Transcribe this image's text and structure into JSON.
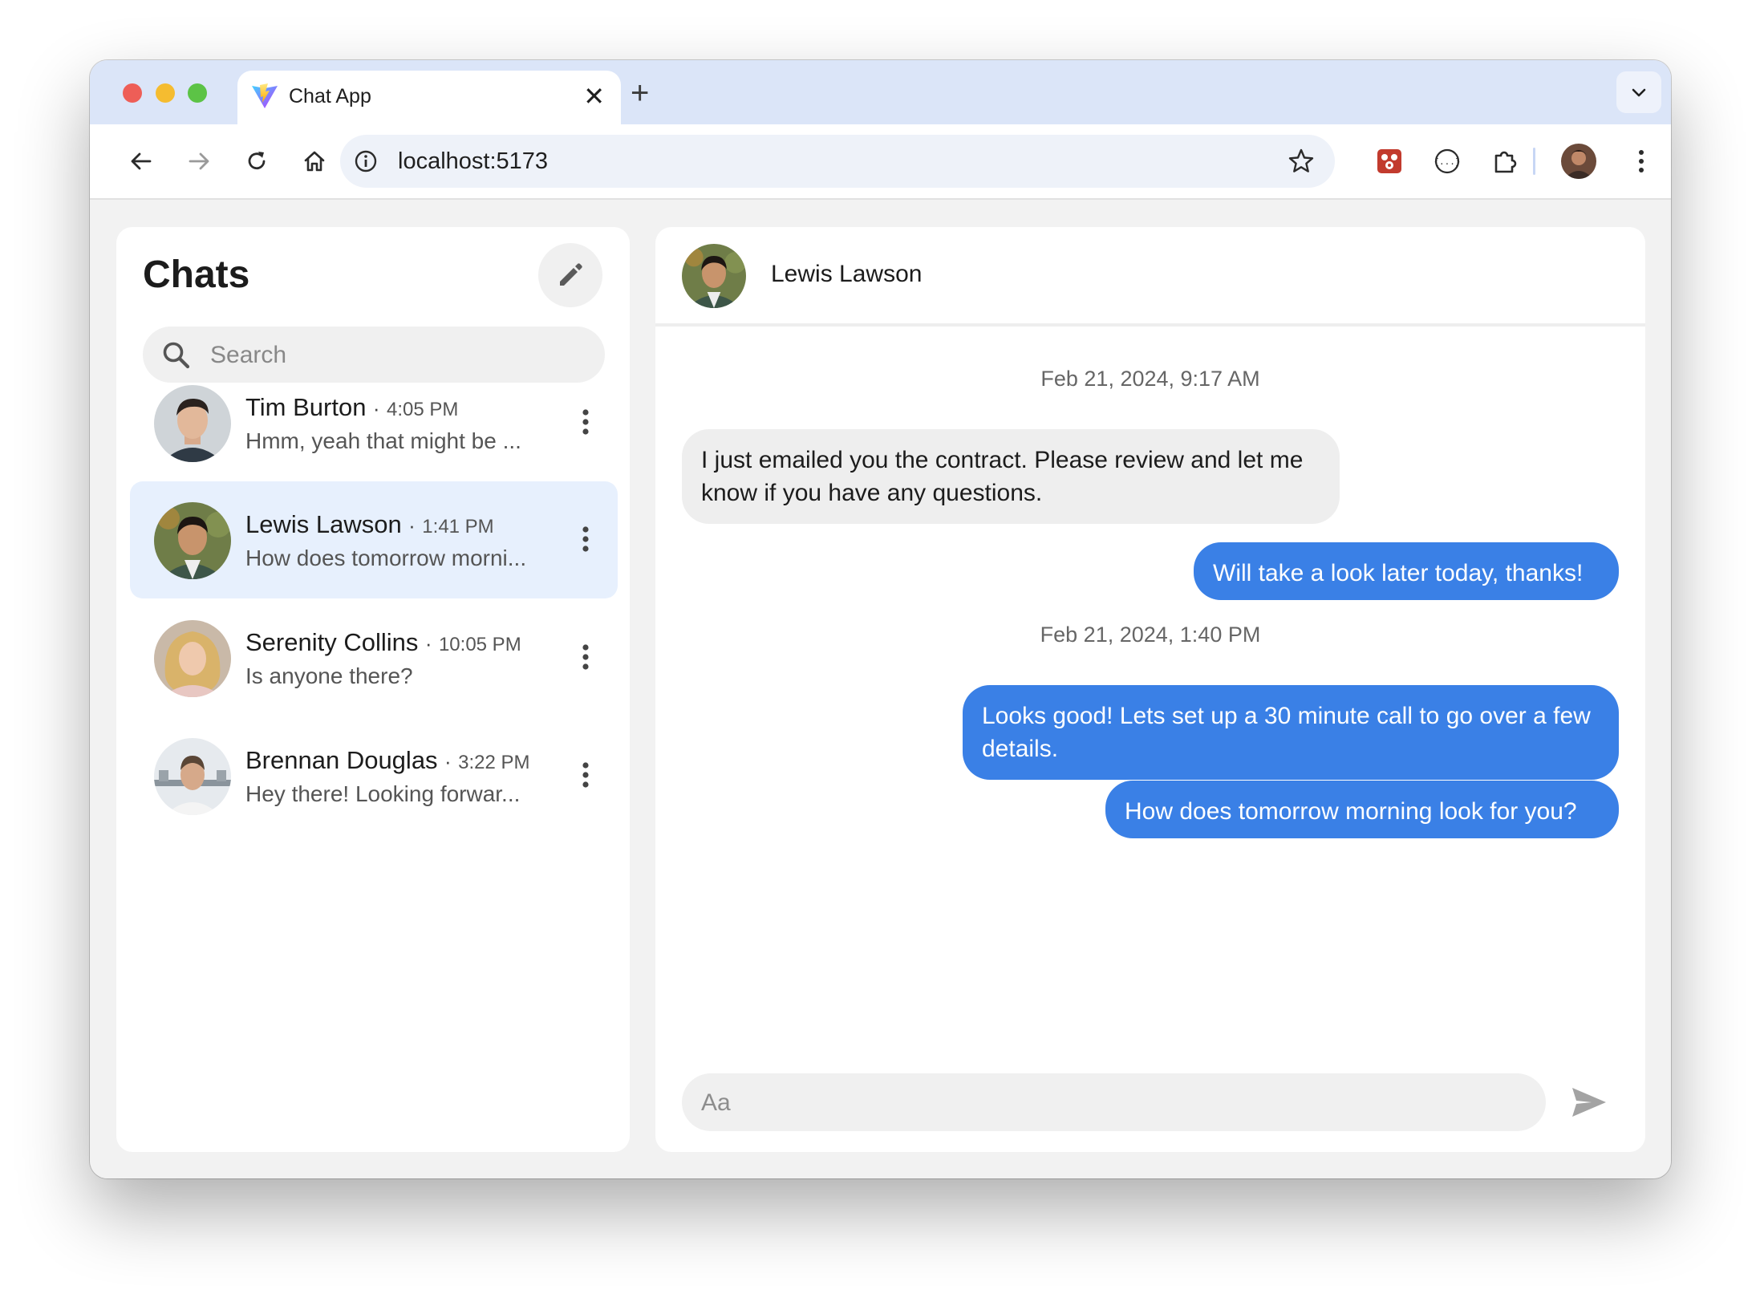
{
  "browser": {
    "tab_title": "Chat App",
    "tab_close": "✕",
    "new_tab": "+",
    "url": "localhost:5173"
  },
  "sidebar": {
    "title": "Chats",
    "search_placeholder": "Search",
    "chats": [
      {
        "name": "Tim Burton",
        "separator": "·",
        "time": "4:05 PM",
        "preview": "Hmm, yeah that might be ...",
        "active": false
      },
      {
        "name": "Lewis Lawson",
        "separator": "·",
        "time": "1:41 PM",
        "preview": "How does tomorrow morni...",
        "active": true
      },
      {
        "name": "Serenity Collins",
        "separator": "·",
        "time": "10:05 PM",
        "preview": "Is anyone there?",
        "active": false
      },
      {
        "name": "Brennan Douglas",
        "separator": "·",
        "time": "3:22 PM",
        "preview": "Hey there! Looking forwar...",
        "active": false
      }
    ]
  },
  "conversation": {
    "contact_name": "Lewis Lawson",
    "timestamps": [
      "Feb 21, 2024, 9:17 AM",
      "Feb 21, 2024, 1:40 PM"
    ],
    "messages": [
      {
        "direction": "incoming",
        "text": "I just emailed you the contract. Please review and let me know if you have any questions."
      },
      {
        "direction": "outgoing",
        "text": "Will take a look later today, thanks!"
      },
      {
        "direction": "outgoing",
        "text": "Looks good! Lets set up a 30 minute call to go over a few details."
      },
      {
        "direction": "outgoing",
        "text": "How does tomorrow morning look for you?"
      }
    ],
    "composer_placeholder": "Aa"
  },
  "colors": {
    "accent": "#3a80e6",
    "active_chat_bg": "#e7f0fd",
    "incoming_bubble": "#eeeeee"
  }
}
